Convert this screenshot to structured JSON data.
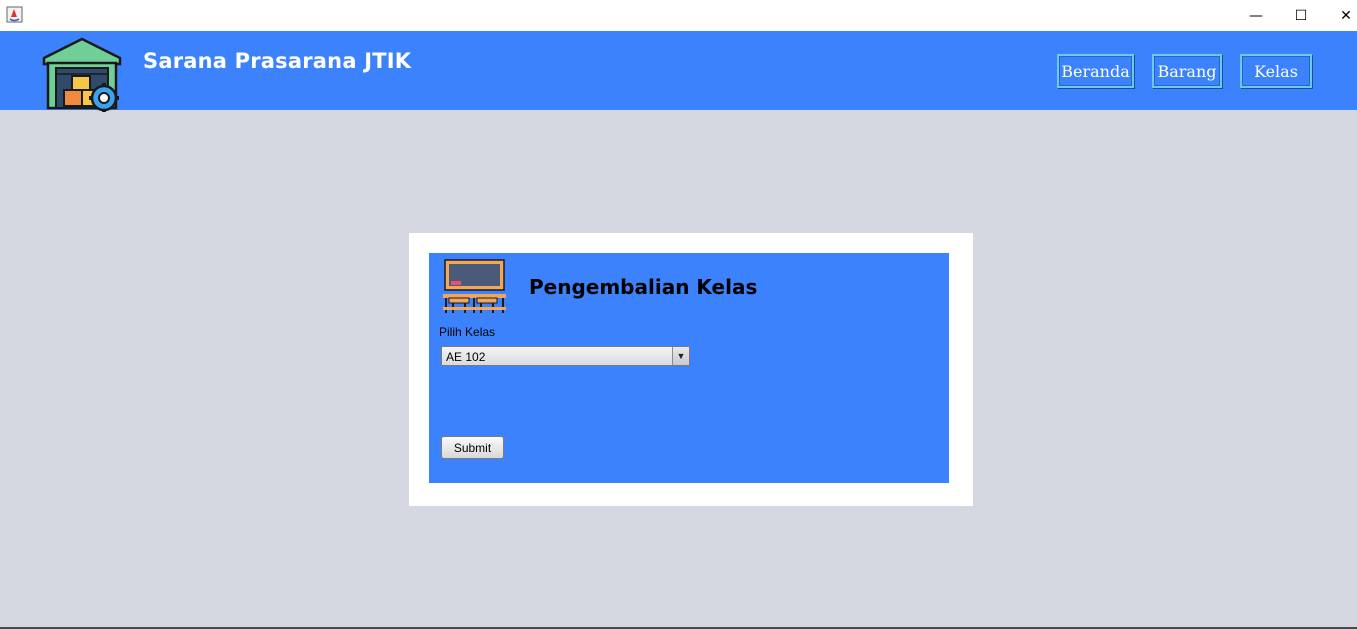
{
  "window": {
    "minimize_glyph": "—",
    "maximize_glyph": "☐",
    "close_glyph": "✕"
  },
  "header": {
    "title": "Sarana Prasarana JTIK",
    "nav": {
      "beranda": "Beranda",
      "barang": "Barang",
      "kelas": "Kelas"
    },
    "logo_icon": "warehouse-gear-icon"
  },
  "form": {
    "title": "Pengembalian Kelas",
    "icon": "classroom-icon",
    "class_label": "Pilih Kelas",
    "class_selected": "AE 102",
    "submit_label": "Submit"
  },
  "colors": {
    "header_bg": "#3b82fc",
    "page_bg": "#d5d8e0",
    "card_bg": "#ffffff"
  }
}
